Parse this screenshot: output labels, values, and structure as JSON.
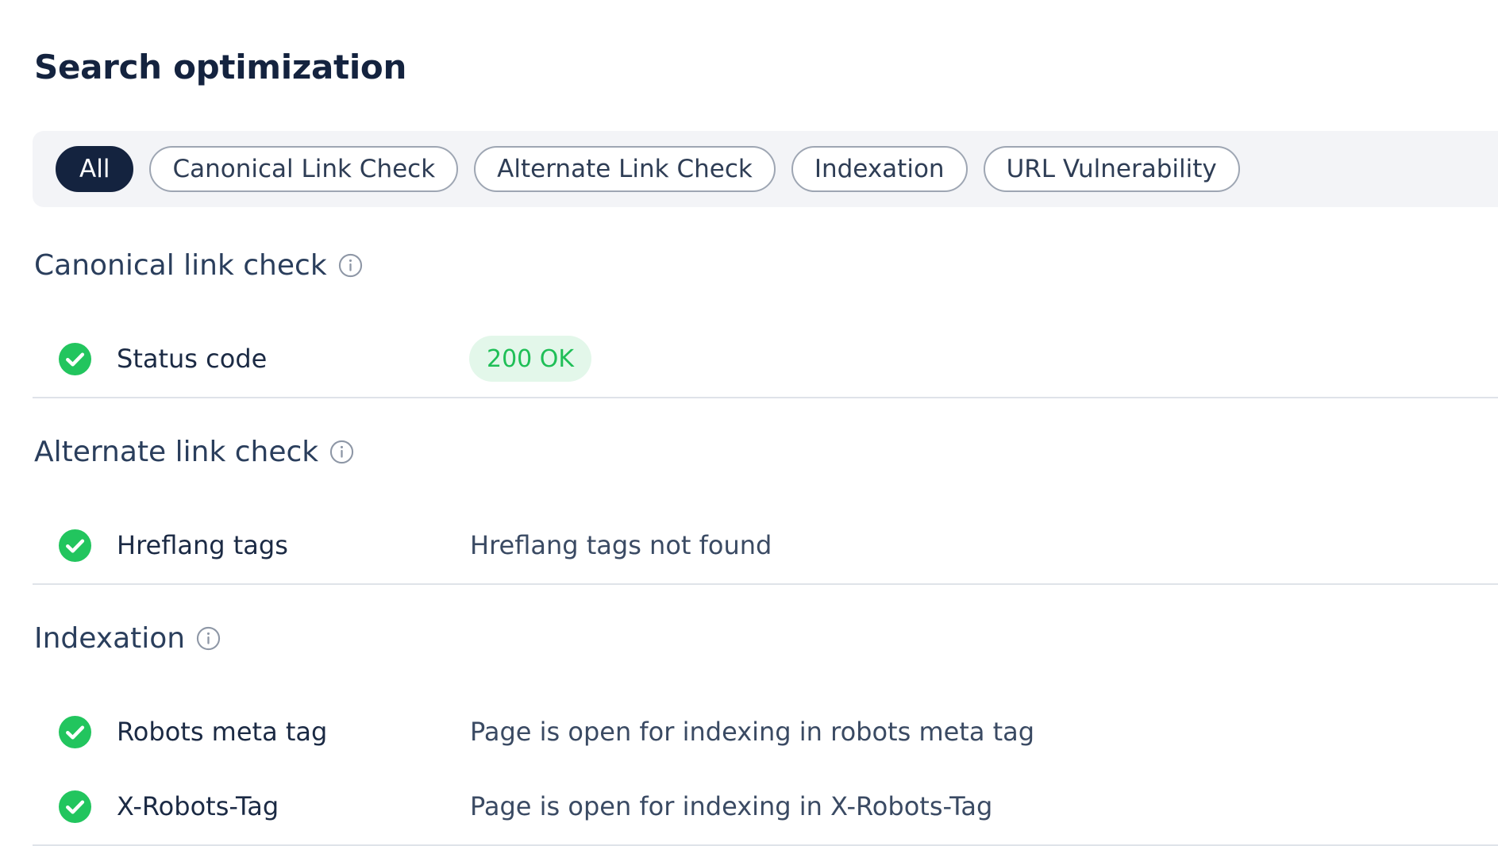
{
  "page": {
    "title": "Search optimization"
  },
  "filters": [
    {
      "label": "All",
      "active": true
    },
    {
      "label": "Canonical Link Check",
      "active": false
    },
    {
      "label": "Alternate Link Check",
      "active": false
    },
    {
      "label": "Indexation",
      "active": false
    },
    {
      "label": "URL Vulnerability",
      "active": false
    }
  ],
  "sections": [
    {
      "heading": "Canonical link check",
      "rows": [
        {
          "label": "Status code",
          "value": "200 OK",
          "status": "pass",
          "value_style": "badge"
        }
      ]
    },
    {
      "heading": "Alternate link check",
      "rows": [
        {
          "label": "Hreflang tags",
          "value": "Hreflang tags not found",
          "status": "pass"
        }
      ]
    },
    {
      "heading": "Indexation",
      "rows": [
        {
          "label": "Robots meta tag",
          "value": "Page is open for indexing in robots meta tag",
          "status": "pass"
        },
        {
          "label": "X-Robots-Tag",
          "value": "Page is open for indexing in X-Robots-Tag",
          "status": "pass"
        }
      ]
    }
  ],
  "icons": {
    "pass": "check-circle-icon",
    "info": "info-icon"
  },
  "colors": {
    "pass": "#22c55e",
    "badge_bg": "#e3f7ea",
    "badge_text": "#1fbf57",
    "active_pill": "#14233f"
  }
}
